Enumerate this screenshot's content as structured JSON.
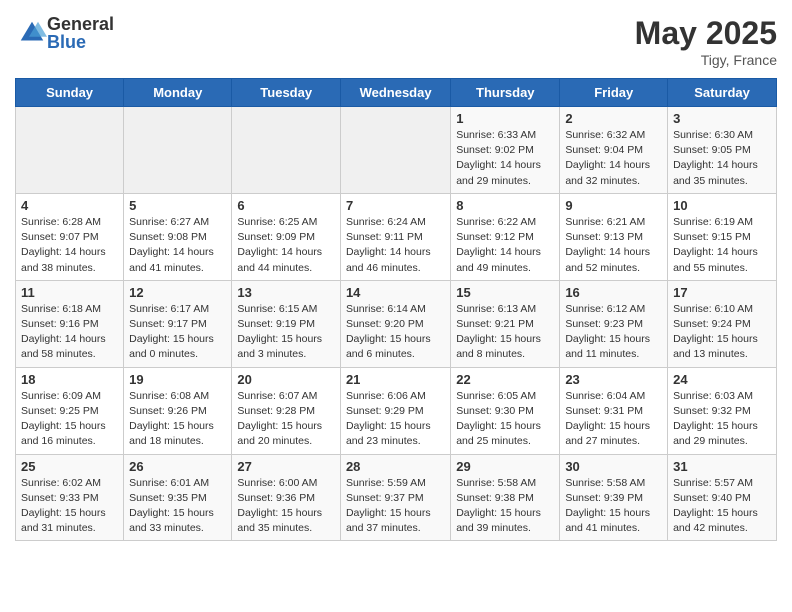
{
  "logo": {
    "general": "General",
    "blue": "Blue"
  },
  "title": "May 2025",
  "location": "Tigy, France",
  "days_header": [
    "Sunday",
    "Monday",
    "Tuesday",
    "Wednesday",
    "Thursday",
    "Friday",
    "Saturday"
  ],
  "weeks": [
    [
      {
        "num": "",
        "info": ""
      },
      {
        "num": "",
        "info": ""
      },
      {
        "num": "",
        "info": ""
      },
      {
        "num": "",
        "info": ""
      },
      {
        "num": "1",
        "info": "Sunrise: 6:33 AM\nSunset: 9:02 PM\nDaylight: 14 hours\nand 29 minutes."
      },
      {
        "num": "2",
        "info": "Sunrise: 6:32 AM\nSunset: 9:04 PM\nDaylight: 14 hours\nand 32 minutes."
      },
      {
        "num": "3",
        "info": "Sunrise: 6:30 AM\nSunset: 9:05 PM\nDaylight: 14 hours\nand 35 minutes."
      }
    ],
    [
      {
        "num": "4",
        "info": "Sunrise: 6:28 AM\nSunset: 9:07 PM\nDaylight: 14 hours\nand 38 minutes."
      },
      {
        "num": "5",
        "info": "Sunrise: 6:27 AM\nSunset: 9:08 PM\nDaylight: 14 hours\nand 41 minutes."
      },
      {
        "num": "6",
        "info": "Sunrise: 6:25 AM\nSunset: 9:09 PM\nDaylight: 14 hours\nand 44 minutes."
      },
      {
        "num": "7",
        "info": "Sunrise: 6:24 AM\nSunset: 9:11 PM\nDaylight: 14 hours\nand 46 minutes."
      },
      {
        "num": "8",
        "info": "Sunrise: 6:22 AM\nSunset: 9:12 PM\nDaylight: 14 hours\nand 49 minutes."
      },
      {
        "num": "9",
        "info": "Sunrise: 6:21 AM\nSunset: 9:13 PM\nDaylight: 14 hours\nand 52 minutes."
      },
      {
        "num": "10",
        "info": "Sunrise: 6:19 AM\nSunset: 9:15 PM\nDaylight: 14 hours\nand 55 minutes."
      }
    ],
    [
      {
        "num": "11",
        "info": "Sunrise: 6:18 AM\nSunset: 9:16 PM\nDaylight: 14 hours\nand 58 minutes."
      },
      {
        "num": "12",
        "info": "Sunrise: 6:17 AM\nSunset: 9:17 PM\nDaylight: 15 hours\nand 0 minutes."
      },
      {
        "num": "13",
        "info": "Sunrise: 6:15 AM\nSunset: 9:19 PM\nDaylight: 15 hours\nand 3 minutes."
      },
      {
        "num": "14",
        "info": "Sunrise: 6:14 AM\nSunset: 9:20 PM\nDaylight: 15 hours\nand 6 minutes."
      },
      {
        "num": "15",
        "info": "Sunrise: 6:13 AM\nSunset: 9:21 PM\nDaylight: 15 hours\nand 8 minutes."
      },
      {
        "num": "16",
        "info": "Sunrise: 6:12 AM\nSunset: 9:23 PM\nDaylight: 15 hours\nand 11 minutes."
      },
      {
        "num": "17",
        "info": "Sunrise: 6:10 AM\nSunset: 9:24 PM\nDaylight: 15 hours\nand 13 minutes."
      }
    ],
    [
      {
        "num": "18",
        "info": "Sunrise: 6:09 AM\nSunset: 9:25 PM\nDaylight: 15 hours\nand 16 minutes."
      },
      {
        "num": "19",
        "info": "Sunrise: 6:08 AM\nSunset: 9:26 PM\nDaylight: 15 hours\nand 18 minutes."
      },
      {
        "num": "20",
        "info": "Sunrise: 6:07 AM\nSunset: 9:28 PM\nDaylight: 15 hours\nand 20 minutes."
      },
      {
        "num": "21",
        "info": "Sunrise: 6:06 AM\nSunset: 9:29 PM\nDaylight: 15 hours\nand 23 minutes."
      },
      {
        "num": "22",
        "info": "Sunrise: 6:05 AM\nSunset: 9:30 PM\nDaylight: 15 hours\nand 25 minutes."
      },
      {
        "num": "23",
        "info": "Sunrise: 6:04 AM\nSunset: 9:31 PM\nDaylight: 15 hours\nand 27 minutes."
      },
      {
        "num": "24",
        "info": "Sunrise: 6:03 AM\nSunset: 9:32 PM\nDaylight: 15 hours\nand 29 minutes."
      }
    ],
    [
      {
        "num": "25",
        "info": "Sunrise: 6:02 AM\nSunset: 9:33 PM\nDaylight: 15 hours\nand 31 minutes."
      },
      {
        "num": "26",
        "info": "Sunrise: 6:01 AM\nSunset: 9:35 PM\nDaylight: 15 hours\nand 33 minutes."
      },
      {
        "num": "27",
        "info": "Sunrise: 6:00 AM\nSunset: 9:36 PM\nDaylight: 15 hours\nand 35 minutes."
      },
      {
        "num": "28",
        "info": "Sunrise: 5:59 AM\nSunset: 9:37 PM\nDaylight: 15 hours\nand 37 minutes."
      },
      {
        "num": "29",
        "info": "Sunrise: 5:58 AM\nSunset: 9:38 PM\nDaylight: 15 hours\nand 39 minutes."
      },
      {
        "num": "30",
        "info": "Sunrise: 5:58 AM\nSunset: 9:39 PM\nDaylight: 15 hours\nand 41 minutes."
      },
      {
        "num": "31",
        "info": "Sunrise: 5:57 AM\nSunset: 9:40 PM\nDaylight: 15 hours\nand 42 minutes."
      }
    ]
  ]
}
